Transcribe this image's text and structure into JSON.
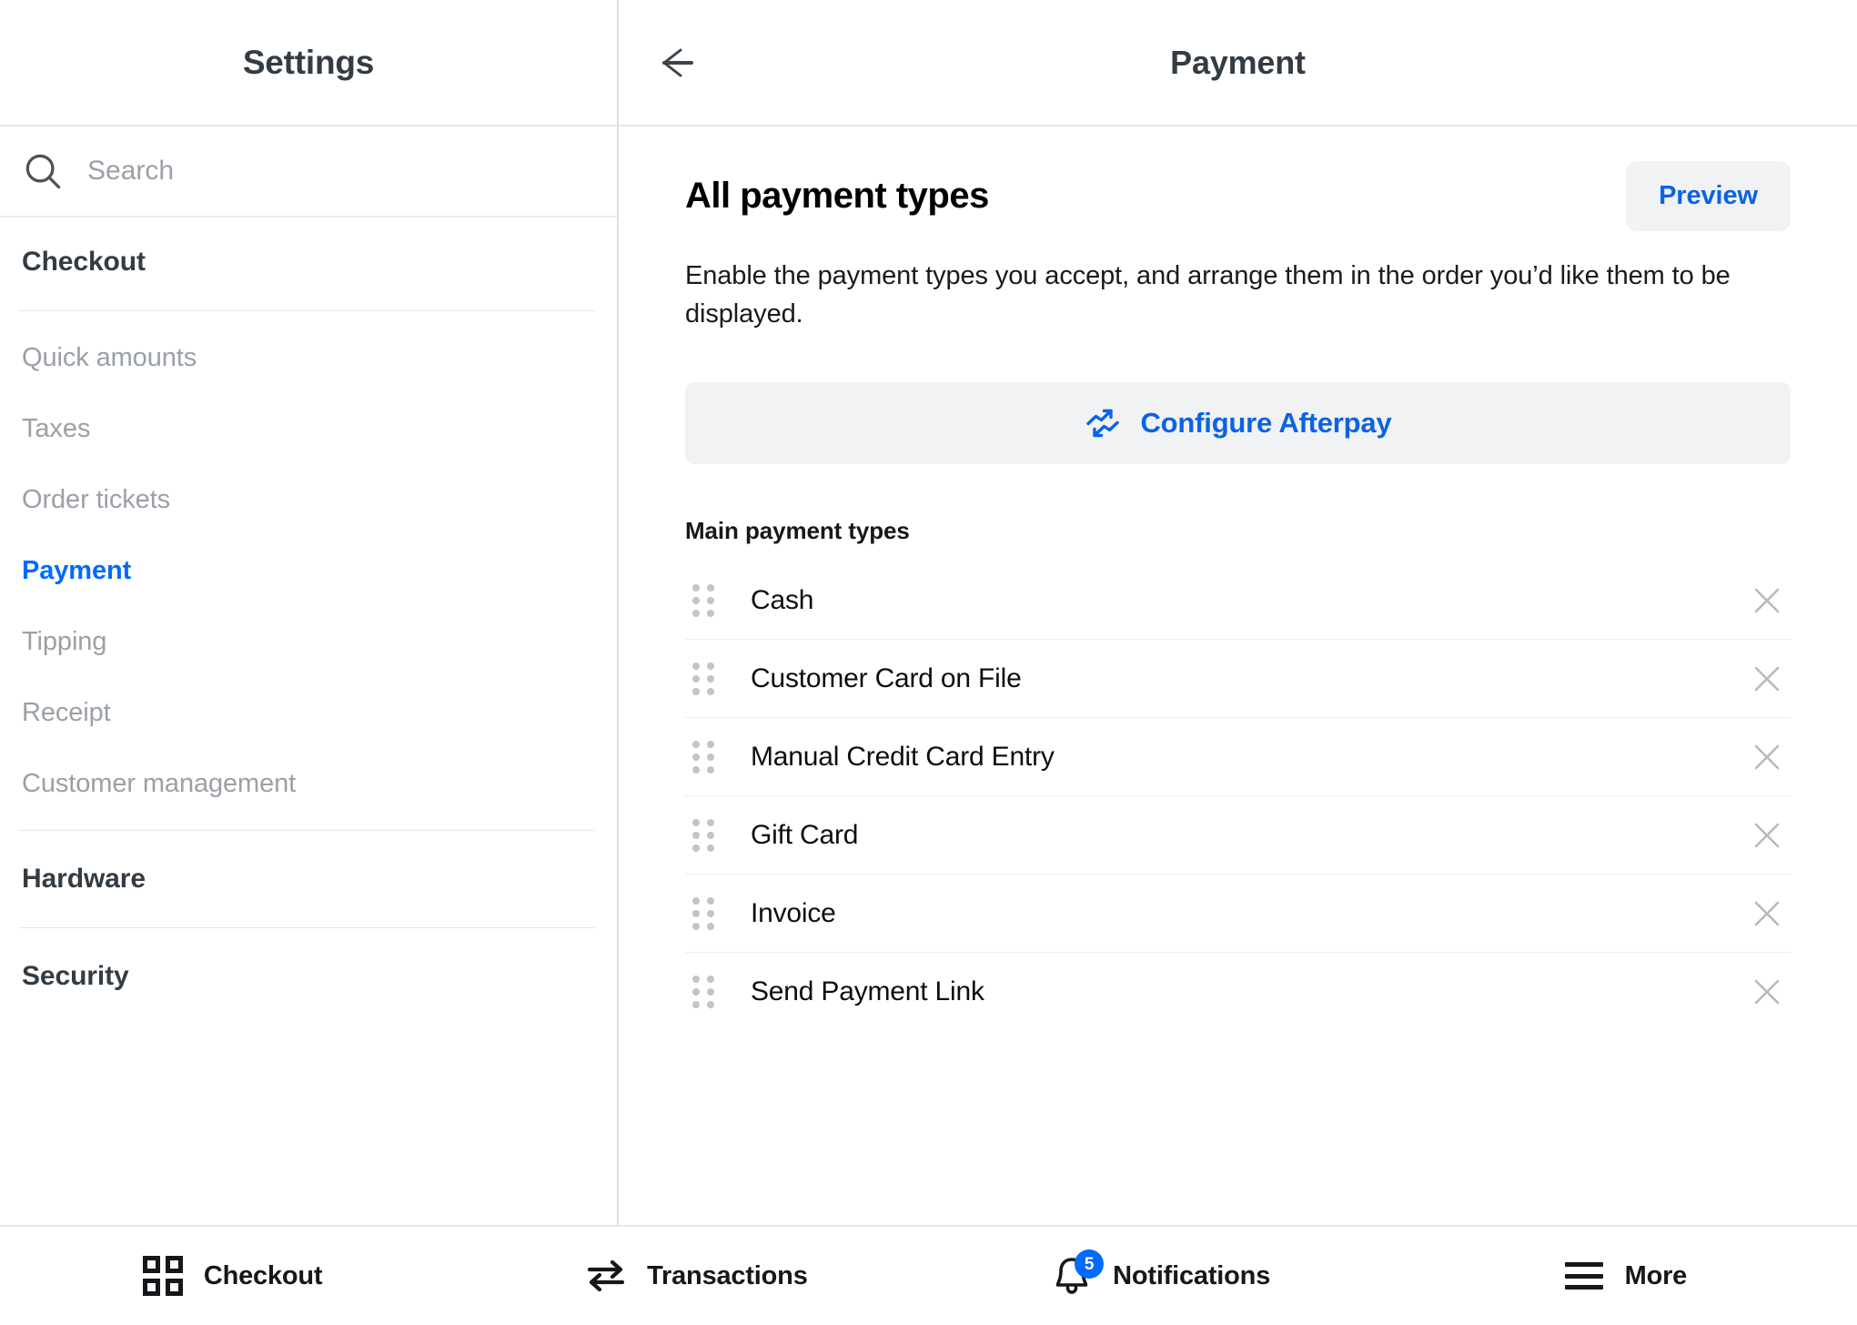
{
  "sidebar": {
    "title": "Settings",
    "search": {
      "placeholder": "Search",
      "value": ""
    },
    "groups": [
      {
        "heading": "Checkout",
        "items": [
          {
            "label": "Quick amounts",
            "active": false
          },
          {
            "label": "Taxes",
            "active": false
          },
          {
            "label": "Order tickets",
            "active": false
          },
          {
            "label": "Payment",
            "active": true
          },
          {
            "label": "Tipping",
            "active": false
          },
          {
            "label": "Receipt",
            "active": false
          },
          {
            "label": "Customer management",
            "active": false
          }
        ]
      },
      {
        "heading": "Hardware",
        "items": []
      },
      {
        "heading": "Security",
        "items": []
      }
    ]
  },
  "main": {
    "header_title": "Payment",
    "back_icon": "arrow-left-icon",
    "section_title": "All payment types",
    "preview_label": "Preview",
    "description": "Enable the payment types you accept, and arrange them in the order you’d like them to be displayed.",
    "afterpay": {
      "label": "Configure Afterpay",
      "icon": "afterpay-logo-icon"
    },
    "group_label": "Main payment types",
    "payment_types": [
      {
        "label": "Cash"
      },
      {
        "label": "Customer Card on File"
      },
      {
        "label": "Manual Credit Card Entry"
      },
      {
        "label": "Gift Card"
      },
      {
        "label": "Invoice"
      },
      {
        "label": "Send Payment Link"
      }
    ]
  },
  "bottom_nav": [
    {
      "label": "Checkout",
      "icon": "grid-icon",
      "badge": ""
    },
    {
      "label": "Transactions",
      "icon": "transfer-arrows-icon",
      "badge": ""
    },
    {
      "label": "Notifications",
      "icon": "bell-icon",
      "badge": "5"
    },
    {
      "label": "More",
      "icon": "hamburger-menu-icon",
      "badge": ""
    }
  ],
  "colors": {
    "accent_blue": "#006aff",
    "link_blue": "#0a63e5",
    "text_dark": "#343c43",
    "text_muted": "#9aa0a6",
    "divider": "#e4e6e7",
    "surface_gray": "#f1f2f3"
  }
}
